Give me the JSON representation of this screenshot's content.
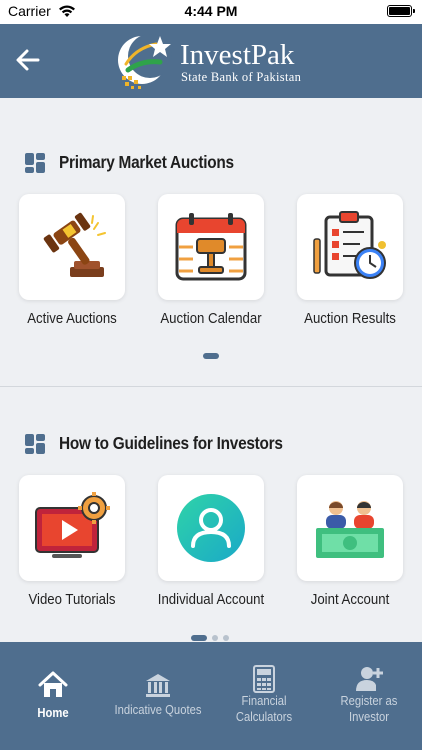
{
  "status_bar": {
    "carrier": "Carrier",
    "time": "4:44 PM"
  },
  "header": {
    "app_name": "InvestPak",
    "subtitle": "State Bank of Pakistan"
  },
  "sections": [
    {
      "title": "Primary Market Auctions",
      "items": [
        {
          "label": "Active Auctions",
          "icon": "gavel-icon"
        },
        {
          "label": "Auction Calendar",
          "icon": "calendar-gavel-icon"
        },
        {
          "label": "Auction Results",
          "icon": "clipboard-clock-icon"
        }
      ]
    },
    {
      "title": "How to Guidelines for Investors",
      "items": [
        {
          "label": "Video Tutorials",
          "icon": "video-gear-icon"
        },
        {
          "label": "Individual Account",
          "icon": "user-circle-icon"
        },
        {
          "label": "Joint Account",
          "icon": "two-people-icon"
        }
      ]
    }
  ],
  "tabs": [
    {
      "line1": "Home",
      "line2": "",
      "icon": "home-icon",
      "active": true
    },
    {
      "line1": "Indicative Quotes",
      "line2": "",
      "icon": "bank-icon",
      "active": false
    },
    {
      "line1": "Financial",
      "line2": "Calculators",
      "icon": "calculator-icon",
      "active": false
    },
    {
      "line1": "Register as",
      "line2": "Investor",
      "icon": "add-user-icon",
      "active": false
    }
  ],
  "colors": {
    "brand": "#4f6e8e",
    "background": "#eef0f3",
    "accent_green": "#2fbf8f"
  }
}
